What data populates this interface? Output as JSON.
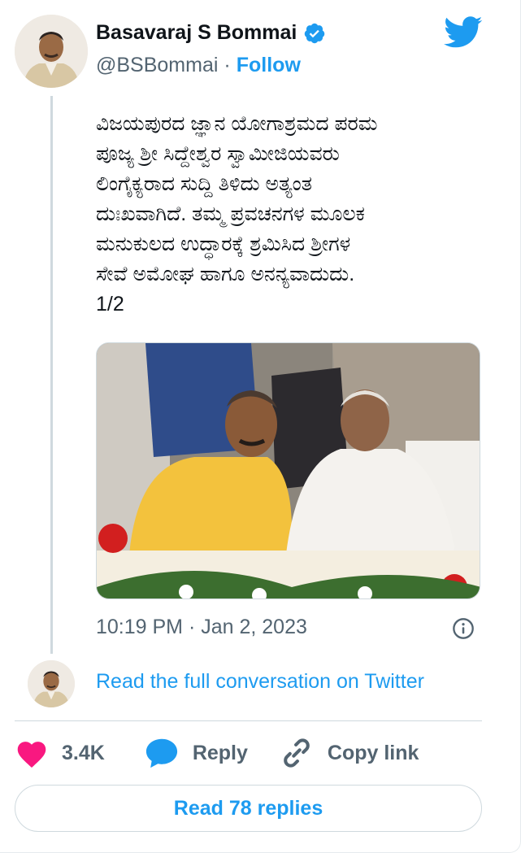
{
  "author": {
    "name": "Basavaraj S Bommai",
    "handle": "@BSBommai",
    "separator": "·",
    "follow_label": "Follow",
    "verified": true
  },
  "tweet": {
    "text": "ವಿಜಯಪುರದ ಜ್ಞಾನ ಯೋಗಾಶ್ರಮದ ಪರಮ\nಪೂಜ್ಯ ಶ್ರೀ ಸಿದ್ದೇಶ್ವರ ಸ್ವಾಮೀಜಿಯವರು\nಲಿಂಗೈಕ್ಯರಾದ ಸುದ್ದಿ ತಿಳಿದು ಅತ್ಯಂತ\nದುಃಖವಾಗಿದೆ. ತಮ್ಮ ಪ್ರವಚನಗಳ ಮೂಲಕ\nಮನುಕುಲದ ಉದ್ಧಾರಕ್ಕೆ ಶ್ರಮಿಸಿದ ಶ್ರೀಗಳ\nಸೇವೆ ಅಮೋಘ ಹಾಗೂ ಅನನ್ಯವಾದುದು.\n1/2",
    "timestamp": "10:19 PM · Jan 2, 2023"
  },
  "conversation": {
    "read_full_label": "Read the full conversation on Twitter"
  },
  "actions": {
    "like_count": "3.4K",
    "reply_label": "Reply",
    "copy_link_label": "Copy link"
  },
  "read_replies_label": "Read 78 replies",
  "colors": {
    "accent": "#1d9bf0",
    "like": "#f91880",
    "muted": "#536471",
    "text": "#0f1419",
    "border": "#cfd9de"
  },
  "icons": [
    "verified-badge-icon",
    "twitter-bird-icon",
    "info-icon",
    "heart-icon",
    "reply-bubble-icon",
    "link-icon"
  ]
}
